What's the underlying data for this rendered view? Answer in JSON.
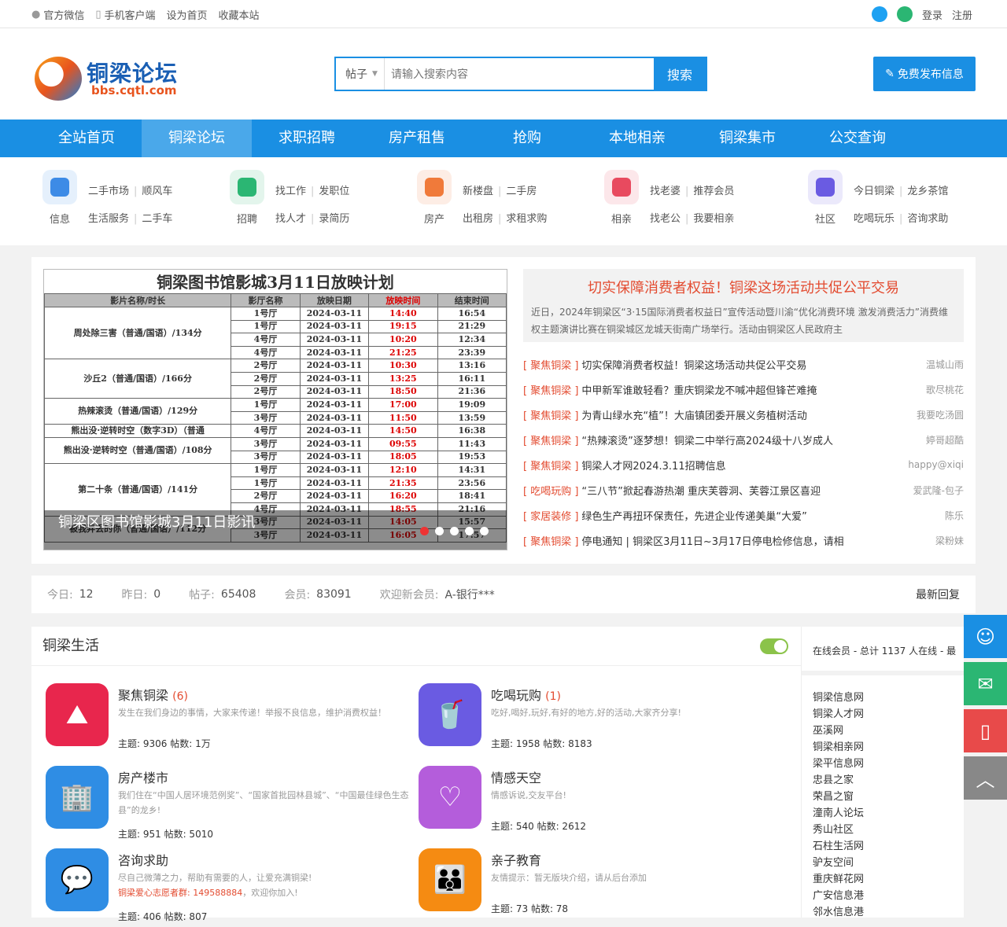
{
  "topbar": {
    "wechat": "官方微信",
    "mobile": "手机客户端",
    "homepage": "设为首页",
    "bookmark": "收藏本站",
    "login": "登录",
    "register": "注册"
  },
  "logo": {
    "cn": "铜梁论坛",
    "url": "bbs.cqtl.com"
  },
  "search": {
    "type": "帖子",
    "placeholder": "请输入搜索内容",
    "button": "搜索"
  },
  "post_button": "免费发布信息",
  "nav": [
    "全站首页",
    "铜梁论坛",
    "求职招聘",
    "房产租售",
    "抢购",
    "本地相亲",
    "铜梁集市",
    "公交查询"
  ],
  "subnav": [
    {
      "label": "信息",
      "color": "#3d8be6",
      "links": [
        [
          "二手市场",
          "顺风车"
        ],
        [
          "生活服务",
          "二手车"
        ]
      ]
    },
    {
      "label": "招聘",
      "color": "#2bb673",
      "links": [
        [
          "找工作",
          "发职位"
        ],
        [
          "找人才",
          "录简历"
        ]
      ]
    },
    {
      "label": "房产",
      "color": "#f07a3a",
      "links": [
        [
          "新楼盘",
          "二手房"
        ],
        [
          "出租房",
          "求租求购"
        ]
      ]
    },
    {
      "label": "相亲",
      "color": "#e84a5f",
      "links": [
        [
          "找老婆",
          "推荐会员"
        ],
        [
          "找老公",
          "我要相亲"
        ]
      ]
    },
    {
      "label": "社区",
      "color": "#6a5be2",
      "links": [
        [
          "今日铜梁",
          "龙乡茶馆"
        ],
        [
          "吃喝玩乐",
          "咨询求助"
        ]
      ]
    }
  ],
  "slider": {
    "title": "铜梁图书馆影城3月11日放映计划",
    "headers": [
      "影片名称/时长",
      "影厅名称",
      "放映日期",
      "放映时间",
      "结束时间"
    ],
    "rows": [
      [
        "周处除三害（普通/国语）/134分",
        "1号厅",
        "2024-03-11",
        "14:40",
        "16:54"
      ],
      [
        "",
        "1号厅",
        "2024-03-11",
        "19:15",
        "21:29"
      ],
      [
        "",
        "4号厅",
        "2024-03-11",
        "10:20",
        "12:34"
      ],
      [
        "",
        "4号厅",
        "2024-03-11",
        "21:25",
        "23:39"
      ],
      [
        "沙丘2（普通/国语）/166分",
        "2号厅",
        "2024-03-11",
        "10:30",
        "13:16"
      ],
      [
        "",
        "2号厅",
        "2024-03-11",
        "13:25",
        "16:11"
      ],
      [
        "",
        "2号厅",
        "2024-03-11",
        "18:50",
        "21:36"
      ],
      [
        "热辣滚烫（普通/国语）/129分",
        "1号厅",
        "2024-03-11",
        "17:00",
        "19:09"
      ],
      [
        "",
        "3号厅",
        "2024-03-11",
        "11:50",
        "13:59"
      ],
      [
        "熊出没·逆转时空（数字3D）（普通",
        "4号厅",
        "2024-03-11",
        "14:50",
        "16:38"
      ],
      [
        "熊出没·逆转时空（普通/国语）/108分",
        "3号厅",
        "2024-03-11",
        "09:55",
        "11:43"
      ],
      [
        "",
        "3号厅",
        "2024-03-11",
        "18:05",
        "19:53"
      ],
      [
        "第二十条（普通/国语）/141分",
        "1号厅",
        "2024-03-11",
        "12:10",
        "14:31"
      ],
      [
        "",
        "1号厅",
        "2024-03-11",
        "21:35",
        "23:56"
      ],
      [
        "",
        "2号厅",
        "2024-03-11",
        "16:20",
        "18:41"
      ],
      [
        "",
        "4号厅",
        "2024-03-11",
        "18:55",
        "21:16"
      ],
      [
        "被我弄丢的你（普通/国语）/112分",
        "3号厅",
        "2024-03-11",
        "14:05",
        "15:57"
      ],
      [
        "",
        "3号厅",
        "2024-03-11",
        "16:05",
        "17:57"
      ]
    ],
    "caption": "铜梁区图书馆影城3月11日影讯"
  },
  "headline": {
    "title": "切实保障消费者权益！铜梁这场活动共促公平交易",
    "desc": "近日，2024年铜梁区“3·15国际消费者权益日”宣传活动暨川渝“优化消费环境 激发消费活力”消费维权主题演讲比赛在铜梁城区龙城天街南广场举行。活动由铜梁区人民政府主"
  },
  "news": [
    {
      "cat": "[ 聚焦铜梁 ]",
      "title": "切实保障消费者权益！铜梁这场活动共促公平交易",
      "author": "温城山雨"
    },
    {
      "cat": "[ 聚焦铜梁 ]",
      "title": "中甲新军谁敢轻看？重庆铜梁龙不喊冲超但锋芒难掩",
      "author": "歌尽桃花"
    },
    {
      "cat": "[ 聚焦铜梁 ]",
      "title": "为青山绿水充“植”！大庙镇团委开展义务植树活动",
      "author": "我要吃汤圆"
    },
    {
      "cat": "[ 聚焦铜梁 ]",
      "title": "“热辣滚烫”逐梦想！铜梁二中举行高2024级十八岁成人",
      "author": "婷哥超酷"
    },
    {
      "cat": "[ 聚焦铜梁 ]",
      "title": "铜梁人才网2024.3.11招聘信息",
      "author": "happy@xiqi"
    },
    {
      "cat": "[ 吃喝玩购 ]",
      "title": "“三八节”掀起春游热潮 重庆芙蓉洞、芙蓉江景区喜迎",
      "author": "爱武隆-包子"
    },
    {
      "cat": "[ 家居装修 ]",
      "title": "绿色生产再扭环保责任，先进企业传递美巢“大爱”",
      "author": "陈乐"
    },
    {
      "cat": "[ 聚焦铜梁 ]",
      "title": "停电通知 | 铜梁区3月11日~3月17日停电检修信息，请相",
      "author": "梁粉妹"
    }
  ],
  "stats": {
    "today_l": "今日:",
    "today": "12",
    "yest_l": "昨日:",
    "yest": "0",
    "posts_l": "帖子:",
    "posts": "65408",
    "members_l": "会员:",
    "members": "83091",
    "new_l": "欢迎新会员:",
    "new": "A-银行***",
    "latest": "最新回复"
  },
  "forum": {
    "title": "铜梁生活",
    "items": [
      {
        "name": "聚焦铜梁",
        "count": "(6)",
        "desc": "发生在我们身边的事情，大家来传递！举报不良信息，维护消费权益！",
        "hl": "",
        "hl2": "",
        "stats": "主题: 9306   帖数: 1万",
        "color": "#e8264d"
      },
      {
        "name": "吃喝玩购",
        "count": "(1)",
        "desc": "吃好,喝好,玩好,有好的地方,好的活动,大家齐分享!",
        "hl": "",
        "hl2": "",
        "stats": "主题: 1958   帖数: 8183",
        "color": "#6a5be2"
      },
      {
        "name": "房产楼市",
        "count": "",
        "desc": "我们住在“中国人居环境范例奖”、“国家首批园林县城”、“中国最佳绿色生态县”的龙乡!",
        "hl": "",
        "hl2": "",
        "stats": "主题: 951   帖数: 5010",
        "color": "#2f8de4"
      },
      {
        "name": "情感天空",
        "count": "",
        "desc": "情感诉说,交友平台!",
        "hl": "",
        "hl2": "",
        "stats": "主题: 540   帖数: 2612",
        "color": "#b45ddb"
      },
      {
        "name": "咨询求助",
        "count": "",
        "desc": "尽自己微薄之力，帮助有需要的人，让爱充满铜梁!",
        "hl": "铜梁爱心志愿者群: 149588884",
        "hl2": "，欢迎你加入!",
        "stats": "主题: 406   帖数: 807",
        "color": "#2f8de4"
      },
      {
        "name": "亲子教育",
        "count": "",
        "desc": "友情提示：暂无版块介绍，请从后台添加",
        "hl": "",
        "hl2": "",
        "stats": "主题: 73   帖数: 78",
        "color": "#f58b12"
      }
    ]
  },
  "sidebar": {
    "header": "在线会员 - 总计 1137 人在线 - 最",
    "links": [
      "铜梁信息网",
      "铜梁人才网",
      "巫溪网",
      "铜梁相亲网",
      "梁平信息网",
      "忠县之家",
      "荣昌之窗",
      "潼南人论坛",
      "秀山社区",
      "石柱生活网",
      "驴友空间",
      "重庆鲜花网",
      "广安信息港",
      "邻水信息港"
    ]
  },
  "float_buttons": [
    {
      "icon": "service-icon",
      "color": "#1a8fe3"
    },
    {
      "icon": "wechat-icon",
      "color": "#2bb673"
    },
    {
      "icon": "phone-icon",
      "color": "#e84a4a"
    },
    {
      "icon": "top-icon",
      "color": "#888888"
    }
  ]
}
